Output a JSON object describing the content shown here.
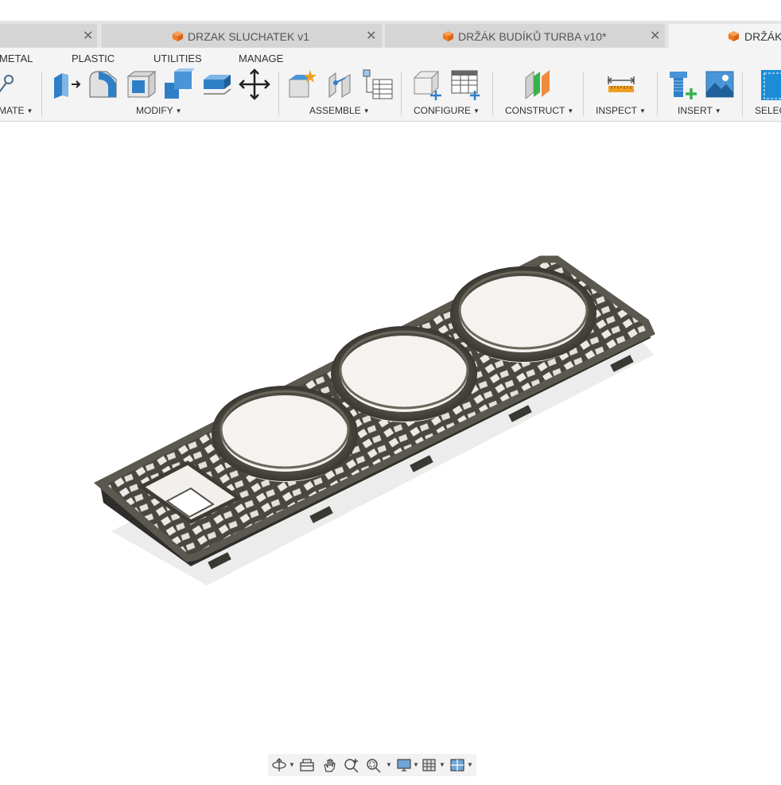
{
  "document_tabs": [
    {
      "label": "",
      "active": false
    },
    {
      "label": "DRZAK SLUCHATEK v1",
      "active": false
    },
    {
      "label": "DRŽÁK BUDÍKŮ TURBA v10*",
      "active": false
    },
    {
      "label": "DRŽÁK",
      "active": true
    }
  ],
  "ribbon_tabs": [
    "METAL",
    "PLASTIC",
    "UTILITIES",
    "MANAGE"
  ],
  "groups": {
    "automate": "MATE",
    "modify": "MODIFY",
    "assemble": "ASSEMBLE",
    "configure": "CONFIGURE",
    "construct": "CONSTRUCT",
    "inspect": "INSPECT",
    "insert": "INSERT",
    "select": "SELEC"
  },
  "icons": {
    "automate": "automate-icon",
    "modify": [
      "press-pull-icon",
      "fillet-icon",
      "shell-icon",
      "combine-icon",
      "offset-face-icon",
      "move-icon"
    ],
    "assemble": [
      "new-component-icon",
      "joint-icon",
      "bom-table-icon"
    ],
    "configure": [
      "configure-icon",
      "configuration-table-icon"
    ],
    "construct": "offset-plane-icon",
    "inspect": "measure-icon",
    "insert": [
      "insert-mcmaster-icon",
      "insert-canvas-icon"
    ],
    "select": "select-icon",
    "nav": [
      "orbit-icon",
      "look-at-icon",
      "pan-icon",
      "zoom-icon",
      "fit-icon",
      "display-settings-icon",
      "grid-icon",
      "viewports-icon"
    ]
  },
  "colors": {
    "cube_orange": "#f07c22",
    "part_dark": "#3f3d36",
    "select_blue": "#1a8dd6"
  }
}
